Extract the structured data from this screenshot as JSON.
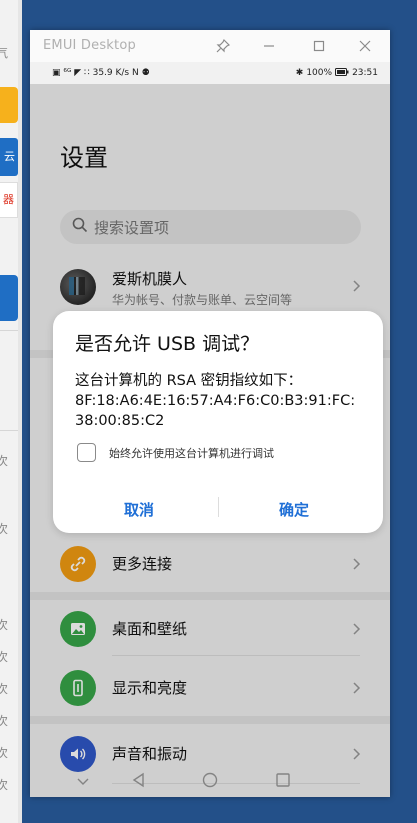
{
  "background": {
    "side_texts": [
      "气",
      "云",
      "器",
      "次",
      "次",
      "次",
      "次",
      "次",
      "次",
      "次",
      "次"
    ]
  },
  "window": {
    "title": "EMUI Desktop"
  },
  "statusbar": {
    "left": "▣ ⁶ᴳ ◤ ∷ 35.9 K/s N ⚉",
    "right_battery": "100%",
    "time": "23:51"
  },
  "settings": {
    "title": "设置",
    "search_placeholder": "搜索设置项",
    "account": {
      "name": "爱斯机膜人",
      "subtitle": "华为帐号、付款与账单、云空间等"
    },
    "items": [
      {
        "label": "更多连接",
        "icon": "link-icon",
        "color": "#f39c12"
      },
      {
        "label": "桌面和壁纸",
        "icon": "image-icon",
        "color": "#37a649"
      },
      {
        "label": "显示和亮度",
        "icon": "phone-brightness-icon",
        "color": "#37a649"
      },
      {
        "label": "声音和振动",
        "icon": "speaker-icon",
        "color": "#2f58c9"
      }
    ]
  },
  "dialog": {
    "title": "是否允许 USB 调试？",
    "body_line1": "这台计算机的 RSA 密钥指纹如下：",
    "body_line2": "8F:18:A6:4E:16:57:A4:F6:C0:B3:91:FC:",
    "body_line3": "38:00:85:C2",
    "checkbox_label": "始终允许使用这台计算机进行调试",
    "checkbox_checked": false,
    "cancel": "取消",
    "confirm": "确定",
    "accent_color": "#1f6fd6"
  }
}
